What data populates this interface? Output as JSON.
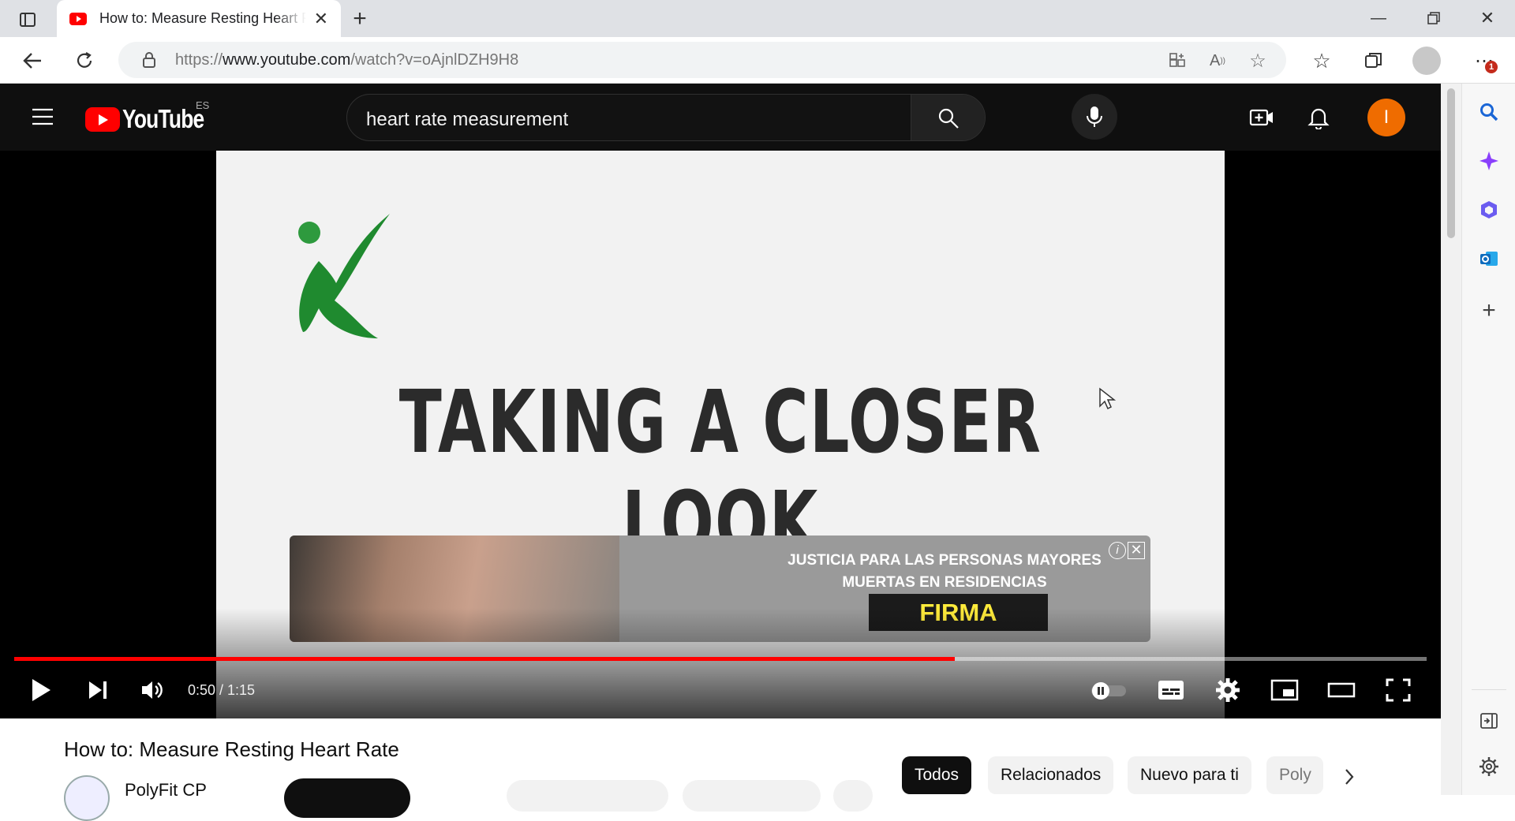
{
  "browser": {
    "tab_title": "How to: Measure Resting Heart Rate - YouTube",
    "url_prefix": "https://",
    "url_domain": "www.youtube.com",
    "url_path": "/watch?v=oAjnlDZH9H8",
    "notification_count": "1"
  },
  "youtube": {
    "logo_text": "YouTube",
    "country_code": "ES",
    "search_value": "heart rate measurement",
    "avatar_letter": "I",
    "avatar_color": "#ef6c00",
    "brand_color": "#ff0000"
  },
  "video": {
    "slide_title": "TAKING A CLOSER LOOK",
    "ad_line1": "JUSTICIA PARA LAS PERSONAS MAYORES",
    "ad_line2": "MUERTAS EN RESIDENCIAS",
    "ad_cta": "FIRMA",
    "ad_badge": "",
    "time_text": "0:50 / 1:15",
    "progress_fraction": 0.666
  },
  "below": {
    "title": "How to: Measure Resting Heart Rate",
    "channel": "PolyFit CP",
    "chips": [
      "Todos",
      "Relacionados",
      "Nuevo para ti",
      "Poly"
    ]
  }
}
